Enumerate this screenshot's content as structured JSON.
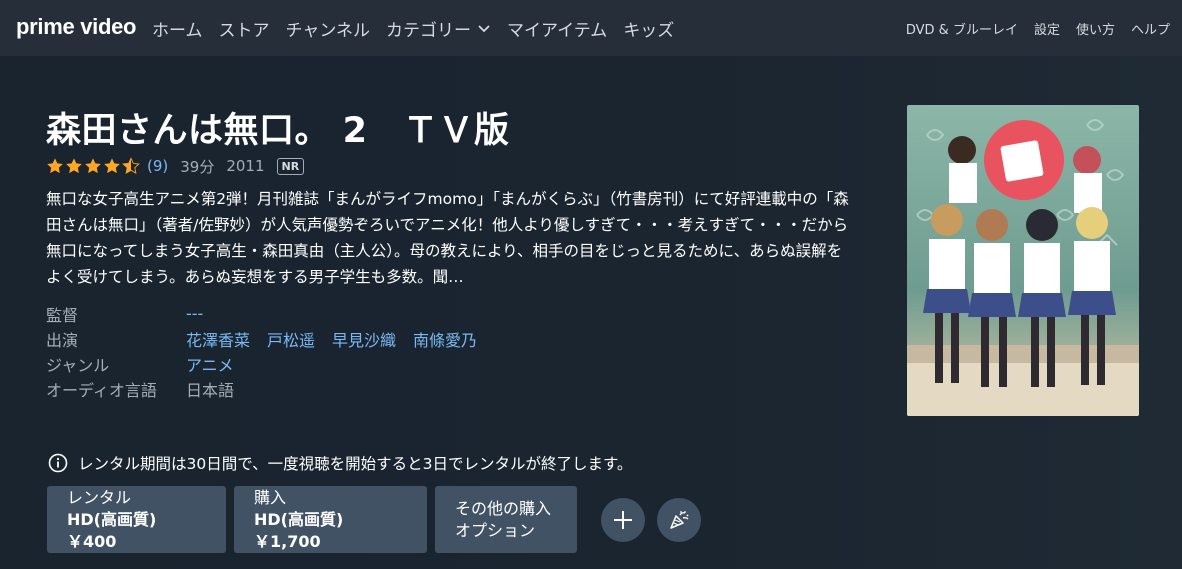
{
  "nav": {
    "logo": "prime video",
    "items": [
      "ホーム",
      "ストア",
      "チャンネル",
      "カテゴリー",
      "マイアイテム",
      "キッズ"
    ],
    "right_items": [
      "DVD & ブルーレイ",
      "設定",
      "使い方",
      "ヘルプ"
    ]
  },
  "title": "森田さんは無口。 2　ＴＶ版",
  "meta": {
    "rating_count": "(9)",
    "duration": "39分",
    "year": "2011",
    "badge": "NR",
    "rating_stars": 4.5
  },
  "synopsis": "無口な女子高生アニメ第2弾！月刊雑誌「まんがライフmomo」「まんがくらぶ」（竹書房刊）にて好評連載中の「森田さんは無口」（著者/佐野妙）が人気声優勢ぞろいでアニメ化！他人より優しすぎて・・・考えすぎて・・・だから無口になってしまう女子高生・森田真由（主人公）。母の教えにより、相手の目をじっと見るために、あらぬ誤解をよく受けてしまう。あらぬ妄想をする男子学生も多数。聞…",
  "details": {
    "director_label": "監督",
    "director_value": "---",
    "cast_label": "出演",
    "cast": [
      "花澤香菜",
      "戸松遥",
      "早見沙織",
      "南條愛乃"
    ],
    "genre_label": "ジャンル",
    "genre_value": "アニメ",
    "audio_label": "オーディオ言語",
    "audio_value": "日本語"
  },
  "poster": {
    "alt_text": "森田さんは無口。",
    "bg_color": "#7aa69a"
  },
  "notice": "レンタル期間は30日間で、一度視聴を開始すると3日でレンタルが終了します。",
  "buttons": {
    "rent_label": "レンタル",
    "rent_price": "HD(高画質) ￥400",
    "buy_label": "購入",
    "buy_price": "HD(高画質) ￥1,700",
    "more_line1": "その他の購入",
    "more_line2": "オプション"
  },
  "colors": {
    "accent_link": "#79b8f3",
    "button_bg": "#425265",
    "star": "#ffa724"
  }
}
